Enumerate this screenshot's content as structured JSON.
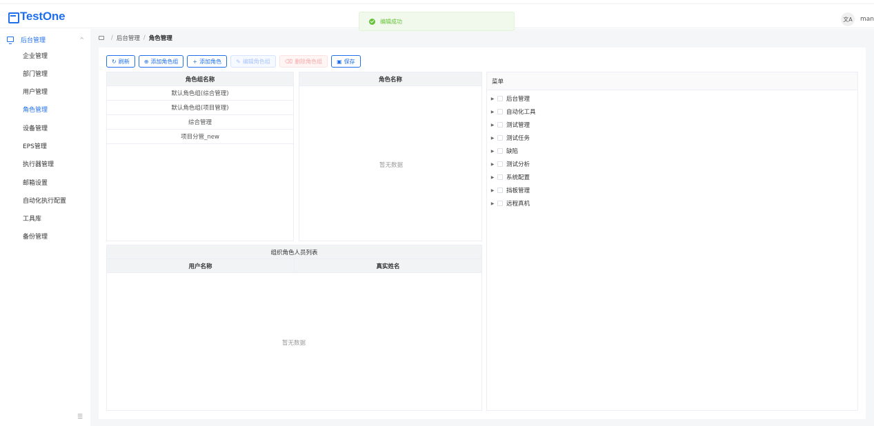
{
  "header": {
    "logo_text": "TestOne",
    "toast_message": "编辑成功",
    "lang_label": "文A",
    "user_name": "manager"
  },
  "sidebar": {
    "group_label": "后台管理",
    "items": [
      {
        "label": "企业管理",
        "active": false
      },
      {
        "label": "部门管理",
        "active": false
      },
      {
        "label": "用户管理",
        "active": false
      },
      {
        "label": "角色管理",
        "active": true
      },
      {
        "label": "设备管理",
        "active": false
      },
      {
        "label": "EPS管理",
        "active": false
      },
      {
        "label": "执行器管理",
        "active": false
      },
      {
        "label": "邮箱设置",
        "active": false
      },
      {
        "label": "自动化执行配置",
        "active": false
      },
      {
        "label": "工具库",
        "active": false
      },
      {
        "label": "备份管理",
        "active": false
      }
    ]
  },
  "breadcrumb": {
    "sep": "/",
    "parent": "后台管理",
    "current": "角色管理"
  },
  "toolbar": {
    "refresh": "刷新",
    "add_group": "添加角色组",
    "add_role": "添加角色",
    "edit_group": "编辑角色组",
    "delete_group": "删除角色组",
    "save": "保存"
  },
  "role_groups": {
    "header": "角色组名称",
    "rows": [
      "默认角色组(综合管理)",
      "默认角色组(项目管理)",
      "综合管理",
      "项目分管_new"
    ]
  },
  "roles": {
    "header": "角色名称",
    "empty": "暂无数据"
  },
  "members": {
    "title": "组织角色人员列表",
    "col_username": "用户名称",
    "col_realname": "真实姓名",
    "empty": "暂无数据"
  },
  "menu_tree": {
    "header": "菜单",
    "nodes": [
      "后台管理",
      "自动化工具",
      "测试管理",
      "测试任务",
      "缺陷",
      "测试分析",
      "系统配置",
      "挡板管理",
      "远程真机"
    ]
  },
  "colors": {
    "primary": "#1f6feb",
    "success": "#67c23a",
    "danger_light": "#f7a8a8"
  }
}
